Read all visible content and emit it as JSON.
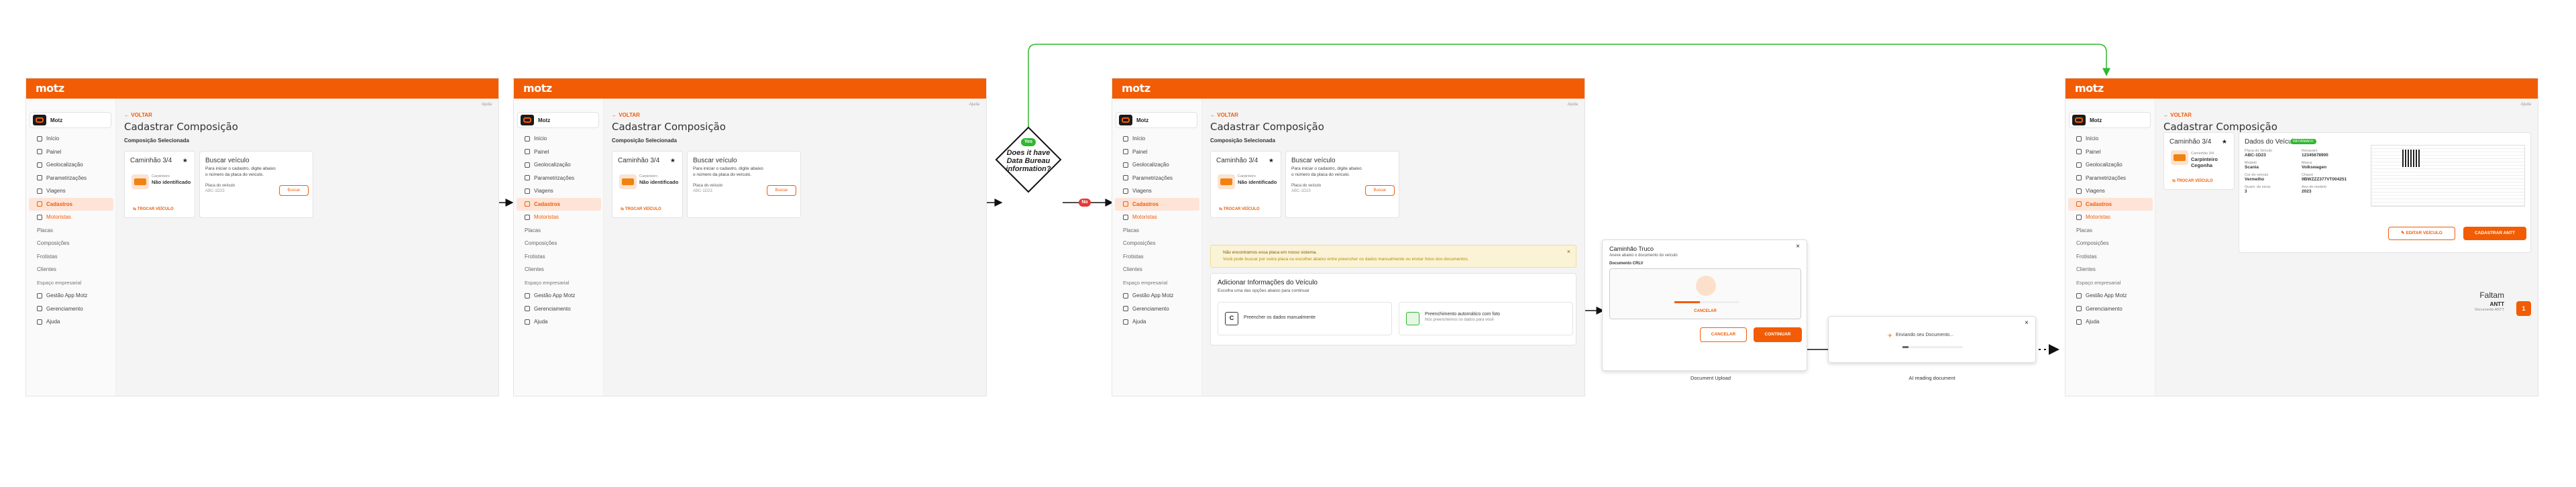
{
  "app": {
    "logo": "motz",
    "org": "Motz",
    "help": "Ajuda",
    "colors": {
      "brand": "#f25c05",
      "yes": "#2eb82e",
      "no": "#e53935"
    }
  },
  "menu": [
    {
      "label": "Início",
      "kind": "item"
    },
    {
      "label": "Painel",
      "kind": "item"
    },
    {
      "label": "Geolocalização",
      "kind": "item"
    },
    {
      "label": "Parametrizações",
      "kind": "item"
    },
    {
      "label": "Viagens",
      "kind": "item"
    },
    {
      "label": "Cadastros",
      "kind": "active"
    },
    {
      "label": "Motoristas",
      "kind": "sub"
    },
    {
      "label": "Placas",
      "kind": "plain"
    },
    {
      "label": "Composições",
      "kind": "plain"
    },
    {
      "label": "Frotistas",
      "kind": "plain"
    },
    {
      "label": "Clientes",
      "kind": "plain"
    },
    {
      "label": "Espaço empresarial",
      "kind": "head"
    },
    {
      "label": "Gestão App Motz",
      "kind": "item"
    },
    {
      "label": "Gerenciamento",
      "kind": "item"
    },
    {
      "label": "Ajuda",
      "kind": "item"
    }
  ],
  "page": {
    "back": "VOLTAR",
    "title": "Cadastrar Composição",
    "section": "Composição Selecionada",
    "card_title": "Caminhão 3/4",
    "star": "★",
    "meta_label": "Carpinteiro",
    "meta_value": "Não identificado",
    "card_link": "TROCAR VEÍCULO"
  },
  "search": {
    "title": "Buscar veículo",
    "desc": "Para iniciar o cadastro, digite abaixo o número da placa do veículo.",
    "plate_label": "Placa do veículo",
    "plate_value": "ABC-1D23",
    "button": "Buscar"
  },
  "decision": {
    "question": "Does it have Data Bureau information?",
    "yes": "Yes",
    "no": "No"
  },
  "screen3": {
    "warning": "Não encontramos essa placa em nosso sistema.",
    "warning_sub": "Você pode buscar por outra placa ou escolher abaixo entre preencher os dados manualmente ou enviar fotos dos documentos.",
    "add_title": "Adicionar Informações do Veículo",
    "add_desc": "Escolha uma das opções abaixo para continuar",
    "opt1": "Preencher os dados manualmente",
    "opt2": "Preenchimento automático com foto",
    "opt2_sub": "Nós preenchemos os dados para você"
  },
  "upload": {
    "title": "Caminhão Truco",
    "desc": "Anexe abaixo o documento do veículo",
    "doc_label": "Documento CRLV",
    "progress_text": "Carregando...",
    "cancel": "CANCELAR",
    "cancel2": "CANCELAR",
    "continue": "CONTINUAR",
    "caption": "Document Upload"
  },
  "reading": {
    "text": "Enviando seu Documento...",
    "caption": "AI reading document"
  },
  "final": {
    "title": "Dados do Veículo",
    "badge": "INFORMADO",
    "card_meta": "Caminhão 3/4",
    "card_value": "Carpinteiro Cegonha",
    "fields": [
      {
        "label": "Placa do Veículo",
        "value": "ABC-1D23"
      },
      {
        "label": "Renavam",
        "value": "12345678900"
      },
      {
        "label": "Modelo",
        "value": "Scania"
      },
      {
        "label": "Marca",
        "value": "Volkswagen"
      },
      {
        "label": "Cor do veículo",
        "value": "Vermelho"
      },
      {
        "label": "Chassi",
        "value": "9BWZZZ377VT004251"
      },
      {
        "label": "Quant. de eixos",
        "value": "3"
      },
      {
        "label": "Ano de modelo",
        "value": "2023"
      }
    ],
    "edit": "EDITAR VEÍCULO",
    "register": "CADASTRAR ANTT",
    "missing_title": "Faltam",
    "missing_item": "ANTT",
    "missing_sub": "Documento ANTT",
    "missing_count": "1"
  }
}
